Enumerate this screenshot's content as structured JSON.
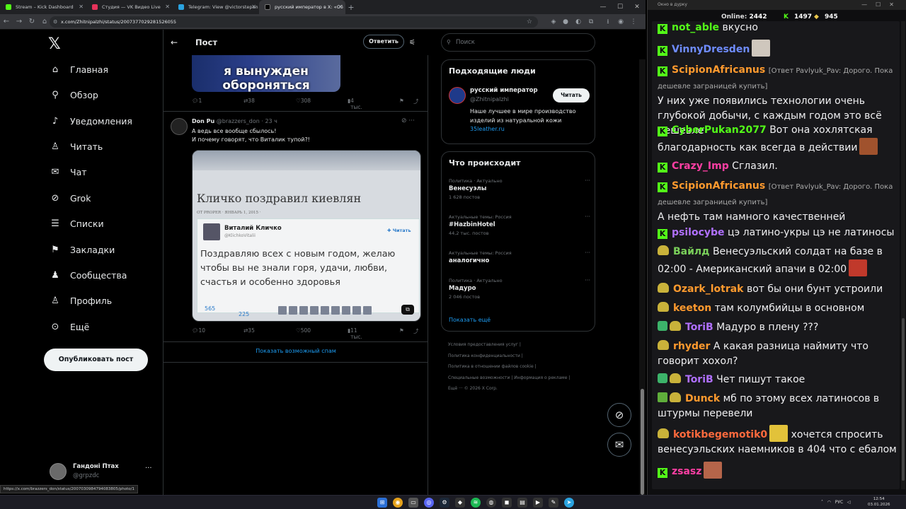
{
  "browser": {
    "tabs": [
      {
        "label": "Stream – Kick Dashboard",
        "color": "#53fc18"
      },
      {
        "label": "Студия — VK Видео Live",
        "color": "#e5325a"
      },
      {
        "label": "Telegram: View @victorstepan",
        "color": "#2aa3e0"
      },
      {
        "label": "русский император в X: «Об",
        "color": "#000000"
      }
    ],
    "url": "x.com/Zhitnipalzhi/status/2007377029281526055",
    "status_link": "https://x.com/brazzers_don/status/2007030984794083805/photo/1"
  },
  "x": {
    "nav": [
      {
        "label": "Главная",
        "icon": "home-icon",
        "glyph": "⌂"
      },
      {
        "label": "Обзор",
        "icon": "search-icon",
        "glyph": "⚲"
      },
      {
        "label": "Уведомления",
        "icon": "bell-icon",
        "glyph": "🔔︎"
      },
      {
        "label": "Читать",
        "icon": "follow-icon",
        "glyph": "👤︎"
      },
      {
        "label": "Чат",
        "icon": "mail-icon",
        "glyph": "✉"
      },
      {
        "label": "Grok",
        "icon": "grok-icon",
        "glyph": "⊘"
      },
      {
        "label": "Списки",
        "icon": "list-icon",
        "glyph": "☰"
      },
      {
        "label": "Закладки",
        "icon": "bookmark-icon",
        "glyph": "🔖︎"
      },
      {
        "label": "Сообщества",
        "icon": "communities-icon",
        "glyph": "👥︎"
      },
      {
        "label": "Профиль",
        "icon": "profile-icon",
        "glyph": "👤︎"
      },
      {
        "label": "Ещё",
        "icon": "more-icon",
        "glyph": "⋯"
      }
    ],
    "post_button": "Опубликовать пост",
    "user": {
      "name": "Гандоні Птах",
      "handle": "@grpzdc"
    },
    "header": {
      "title": "Пост",
      "reply_button": "Ответить"
    },
    "top_image_text": [
      "я вынужден",
      "обороняться"
    ],
    "top_actions": {
      "replies": "1",
      "reposts": "38",
      "likes": "308",
      "views": "4 тыс."
    },
    "tweet": {
      "name": "Don Pu",
      "handle": "@brazzers_don",
      "time": "· 23 ч",
      "line1": "А ведь все вообще  сбылось!",
      "line2": "И почему говорят, что Виталик тупой?!",
      "image": {
        "headline": "Кличко поздравил киевлян",
        "meta": "ОТ PROPER · ЯНВАРЬ 1, 2015 ·",
        "author": "Виталий Кличко",
        "author_handle": "@KlichkoVitalii",
        "follow": "Читать",
        "text1": "Поздравляю всех с новым годом, желаю",
        "text2": "чтобы вы не знали горя, удачи, любви,",
        "text3": "счастья и особенно здоровья",
        "n1": "565",
        "n2": "225"
      },
      "actions": {
        "replies": "10",
        "reposts": "35",
        "likes": "500",
        "views": "11 тыс."
      }
    },
    "spam_link": "Показать возможный спам",
    "search_placeholder": "Поиск",
    "who_to_follow": {
      "title": "Подходящие люди",
      "name": "русский император",
      "handle": "@Zhitnipalzhi",
      "follow": "Читать",
      "bio1": "Наше лучшее в мире производство",
      "bio2": "изделий из натуральной кожи",
      "link": "35leather.ru"
    },
    "trends": {
      "title": "Что происходит",
      "items": [
        {
          "category": "Политика · Актуально",
          "topic": "Венесуэлы",
          "count": "1 628 постов"
        },
        {
          "category": "Актуальные темы: Россия",
          "topic": "#HazbinHotel",
          "count": "44,2 тыс. постов"
        },
        {
          "category": "Актуальные темы: Россия",
          "topic": "аналогично",
          "count": ""
        },
        {
          "category": "Политика · Актуально",
          "topic": "Мадуро",
          "count": "2 046 постов"
        }
      ],
      "show_more": "Показать ещё"
    },
    "footer": [
      "Условия предоставления услуг",
      "Политика конфиденциальности",
      "Политика в отношении файлов cookie",
      "Специальные возможности",
      "Информация о рекламе",
      "Ещё ···",
      "© 2026 X Corp."
    ]
  },
  "chat": {
    "window_title": "Окно в дурку",
    "online_label": "Online:",
    "online": "2442",
    "kick_count": "1497",
    "gold_count": "945",
    "messages": [
      {
        "nick": "not_able",
        "color": "#53fc18",
        "text": "вкусно"
      },
      {
        "nick": "VinnyDresden",
        "color": "#6f8cff",
        "text": ""
      },
      {
        "nick": "ScipionAfricanus",
        "color": "#ff9a2e",
        "reply": "[Ответ Pavlyuk_Pav: Дорого. Пока дешевле заграницей купить]",
        "text": "У них уже появились технологии очень глубокой добычи, с каждым годом это всё дешевле"
      },
      {
        "nick": "CyberPukan2077",
        "color": "#53fc18",
        "text": "Вот она хохлятская благодарность как всегда в действии"
      },
      {
        "nick": "Crazy_Imp",
        "color": "#ff3fa4",
        "text": "Сглазил."
      },
      {
        "nick": "ScipionAfricanus",
        "color": "#ff9a2e",
        "reply": "[Ответ Pavlyuk_Pav: Дорого. Пока дешевле заграницей купить]",
        "text": "А нефть там намного качественней"
      },
      {
        "nick": "psilocybe",
        "color": "#b070ff",
        "text": "цэ латино-укры цэ не латиносы"
      },
      {
        "nick": "Вайлд",
        "color": "#7ad05a",
        "text": "Венесуэльский солдат на базе в 02:00 - Американский апачи в 02:00"
      },
      {
        "nick": "Ozark_lotrak",
        "color": "#ff9a2e",
        "text": "вот бы они бунт устроили"
      },
      {
        "nick": "keeton",
        "color": "#ff9a2e",
        "text": "там колумбийцы в основном"
      },
      {
        "nick": "ToriB",
        "color": "#b070ff",
        "text": "Мадуро в плену ???"
      },
      {
        "nick": "rhyder",
        "color": "#ff9a2e",
        "text": "А какая разница наймиту что говорит хохол?"
      },
      {
        "nick": "ToriB",
        "color": "#b070ff",
        "text": "Чет пишут такое"
      },
      {
        "nick": "Dunck",
        "color": "#ff9a2e",
        "text": "мб по этому всех латиносов в штурмы перевели"
      },
      {
        "nick": "kotikbegemotik0",
        "color": "#ff6a3d",
        "text": "хочется спросить венесуэльских наемников в 404 что с ебалом"
      },
      {
        "nick": "zsasz",
        "color": "#ff3fa4",
        "text": ""
      }
    ]
  },
  "taskbar": {
    "lang": "РУС",
    "time": "12:54",
    "date": "03.01.2026"
  }
}
